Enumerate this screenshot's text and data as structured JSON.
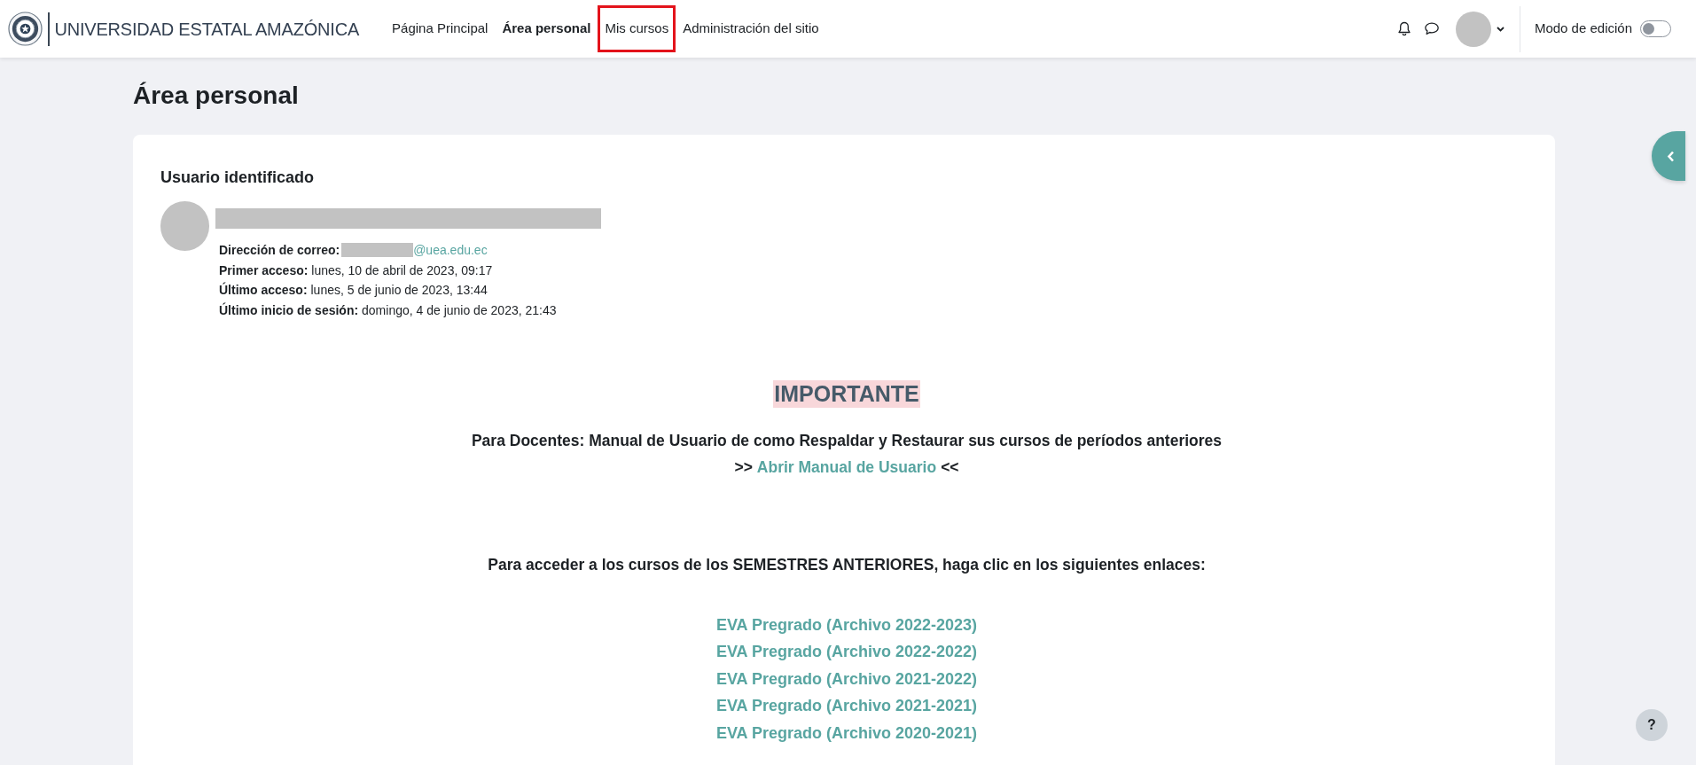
{
  "header": {
    "site_name": "UNIVERSIDAD ESTATAL AMAZÓNICA",
    "nav": [
      {
        "label": "Página Principal",
        "selected": false,
        "highlighted": false
      },
      {
        "label": "Área personal",
        "selected": true,
        "highlighted": false
      },
      {
        "label": "Mis cursos",
        "selected": false,
        "highlighted": true
      },
      {
        "label": "Administración del sitio",
        "selected": false,
        "highlighted": false
      }
    ],
    "edit_mode": {
      "label": "Modo de edición",
      "on": false
    }
  },
  "page_title": "Área personal",
  "user_block": {
    "title": "Usuario identificado",
    "details": [
      {
        "kind": "email",
        "label": "Dirección de correo:",
        "value": "@uea.edu.ec"
      },
      {
        "kind": "text",
        "label": "Primer acceso:",
        "value": "lunes, 10 de abril de 2023, 09:17"
      },
      {
        "kind": "text",
        "label": "Último acceso:",
        "value": "lunes, 5 de junio de 2023, 13:44"
      },
      {
        "kind": "text",
        "label": "Último inicio de sesión:",
        "value": "domingo, 4 de junio de 2023, 21:43"
      }
    ]
  },
  "notice": {
    "heading": "IMPORTANTE",
    "intro": "Para Docentes: Manual de Usuario de como Respaldar y Restaurar sus cursos de períodos anteriores",
    "manual_link": {
      "before": ">>",
      "label": "Abrir Manual de Usuario",
      "after": "<<"
    },
    "archive_intro": "Para acceder a los cursos de los SEMESTRES ANTERIORES, haga clic en los siguientes enlaces:",
    "archive_links": [
      "EVA Pregrado (Archivo 2022-2023)",
      "EVA Pregrado (Archivo 2022-2022)",
      "EVA Pregrado (Archivo 2021-2022)",
      "EVA Pregrado (Archivo 2021-2021)",
      "EVA Pregrado (Archivo 2020-2021)"
    ]
  },
  "help_button": {
    "label": "?"
  }
}
